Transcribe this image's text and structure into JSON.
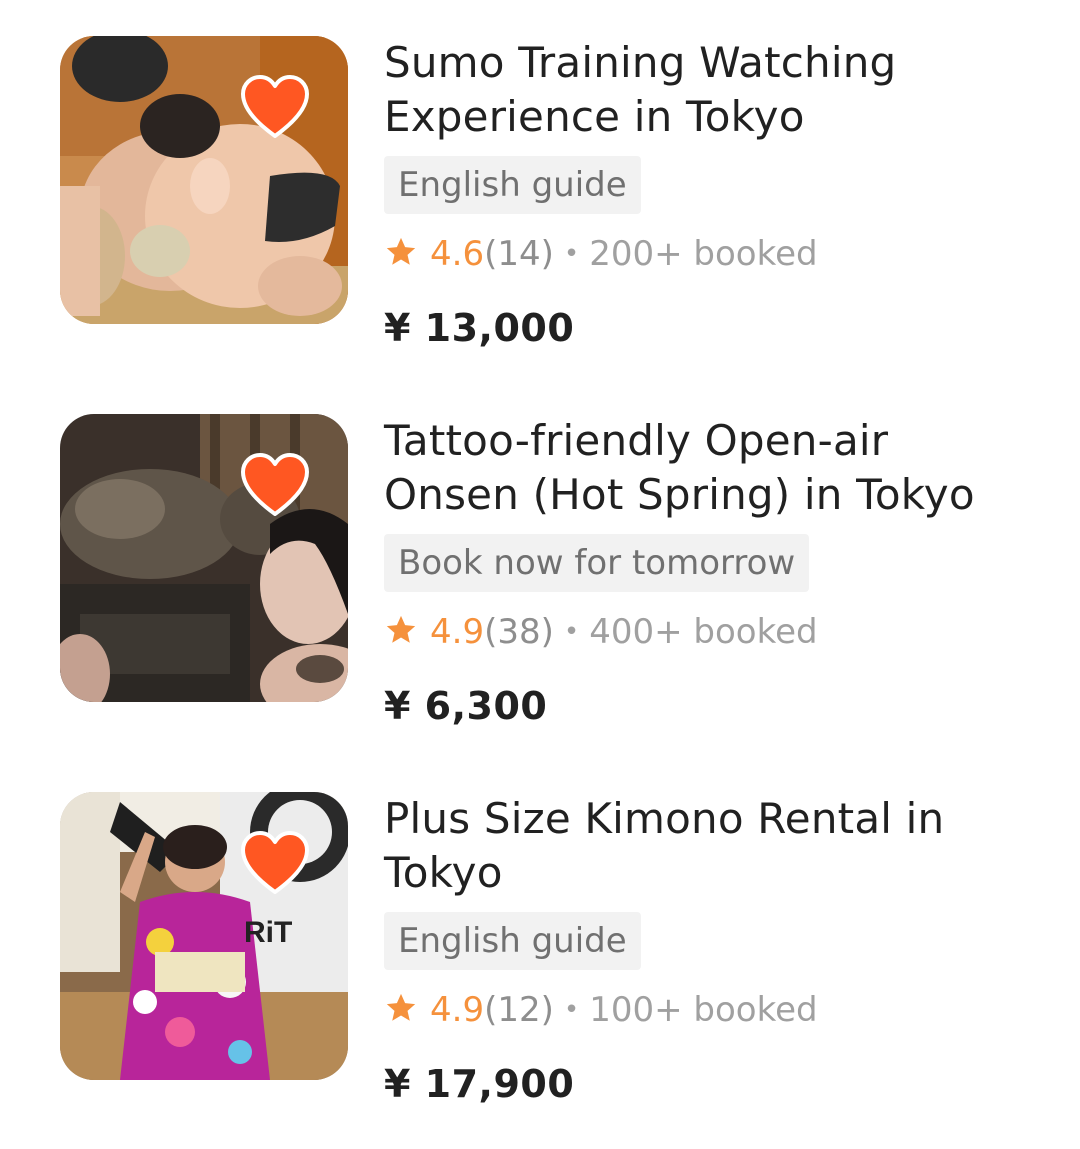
{
  "colors": {
    "accent": "#FF5722",
    "rating": "#F5913C",
    "tag_bg": "#F2F2F2",
    "text": "#212121",
    "muted": "#A0A0A0"
  },
  "items": [
    {
      "title": "Sumo Training Watching Experience in Tokyo",
      "tag": "English guide",
      "rating": "4.6",
      "reviews": "(14)",
      "separator": "•",
      "booked": "200+ booked",
      "price": "¥ 13,000",
      "icon": "heart-icon"
    },
    {
      "title": "Tattoo-friendly Open-air Onsen (Hot Spring) in Tokyo",
      "tag": "Book now for tomorrow",
      "rating": "4.9",
      "reviews": "(38)",
      "separator": "•",
      "booked": "400+ booked",
      "price": "¥ 6,300",
      "icon": "heart-icon"
    },
    {
      "title": "Plus Size Kimono Rental in Tokyo",
      "tag": "English guide",
      "rating": "4.9",
      "reviews": "(12)",
      "separator": "•",
      "booked": "100+ booked",
      "price": "¥ 17,900",
      "icon": "heart-icon"
    }
  ]
}
